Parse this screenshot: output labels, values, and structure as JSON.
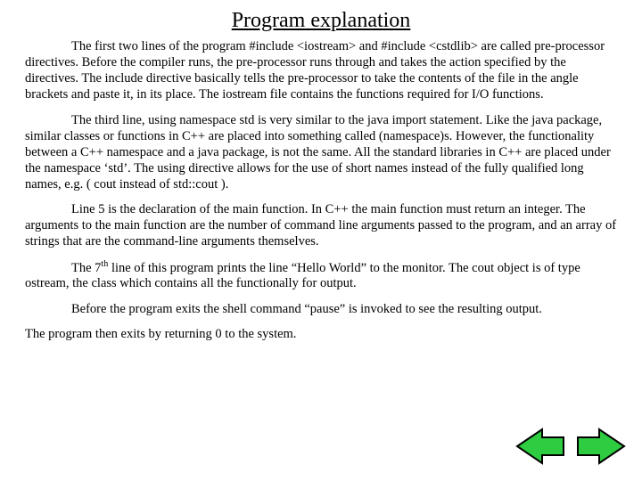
{
  "title": "Program explanation",
  "paragraphs": {
    "p1": "The first two lines of the program #include <iostream> and #include <cstdlib> are called pre-processor directives. Before the compiler runs, the pre-processor runs through and takes the action specified by the directives. The include directive basically tells the pre-processor to take the contents of the file in the angle brackets and paste it, in its place. The iostream file contains the functions required for I/O functions.",
    "p2": "The third line, using namespace std  is very similar to the java import statement. Like the java package, similar classes or functions in C++ are placed into something called (namespace)s. However, the functionality between a C++ namespace and a java package, is not the same. All the standard libraries in C++ are placed under the namespace ‘std’. The using directive allows for the use of short names instead of the fully qualified long names, e.g. ( cout instead of std::cout ).",
    "p3": "Line 5 is the declaration of the main function. In C++ the main function must return an integer. The arguments to the main function are the number of command line arguments passed to the program, and an array of strings that are the command-line arguments themselves.",
    "p4_pre": "The 7",
    "p4_sup": "th",
    "p4_post": " line of this program prints the line “Hello World” to the monitor. The cout object is of type ostream, the class which contains all the functionally for output.",
    "p5": "Before the program exits the shell command “pause” is invoked to see the resulting output.",
    "p6": "The program then exits by returning 0 to the system."
  },
  "nav": {
    "prev": "previous",
    "next": "next"
  },
  "colors": {
    "arrow_fill": "#2ecc40",
    "arrow_stroke": "#000000"
  }
}
